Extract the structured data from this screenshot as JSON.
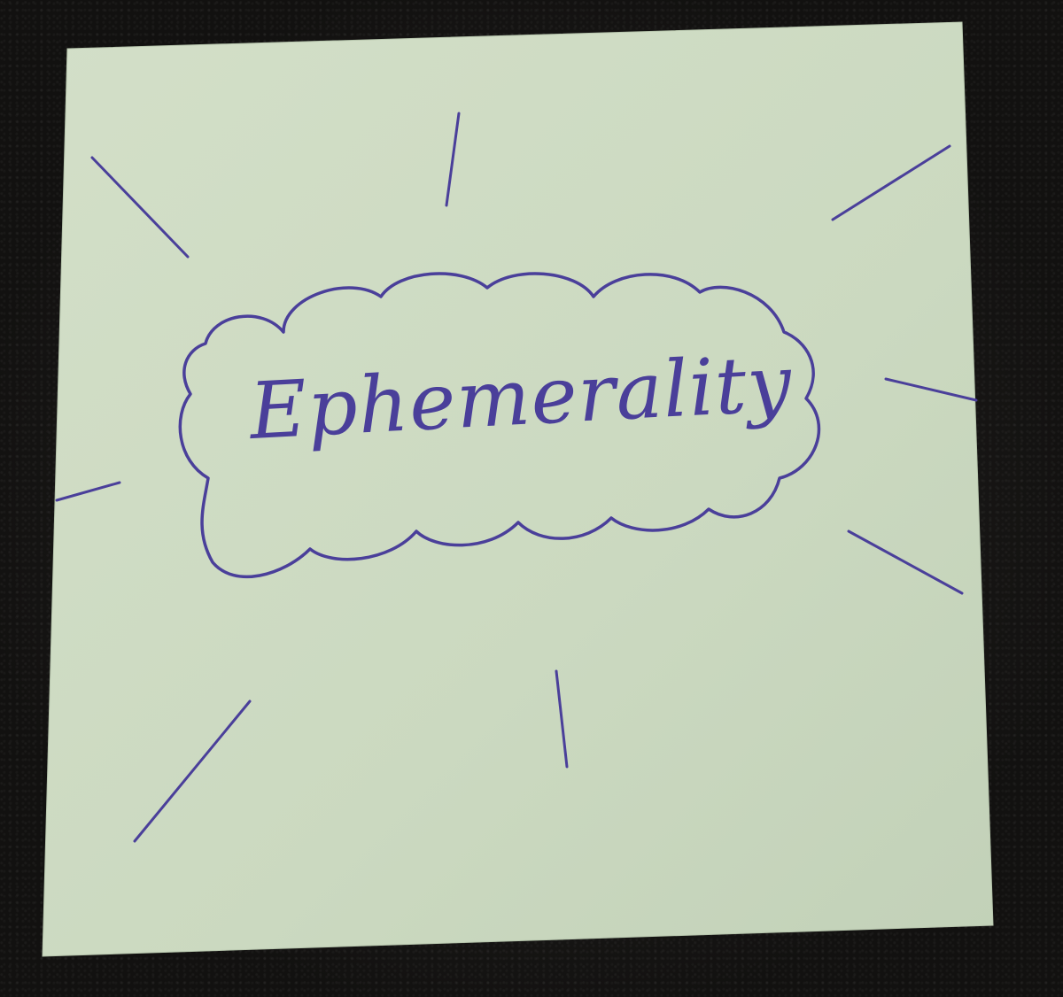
{
  "scene": {
    "subject": "sticky-note",
    "note_color": "#cfdcc4",
    "ink_color": "#4a3f9a",
    "background_color": "#161514"
  },
  "note": {
    "word": "Ephemerality"
  }
}
